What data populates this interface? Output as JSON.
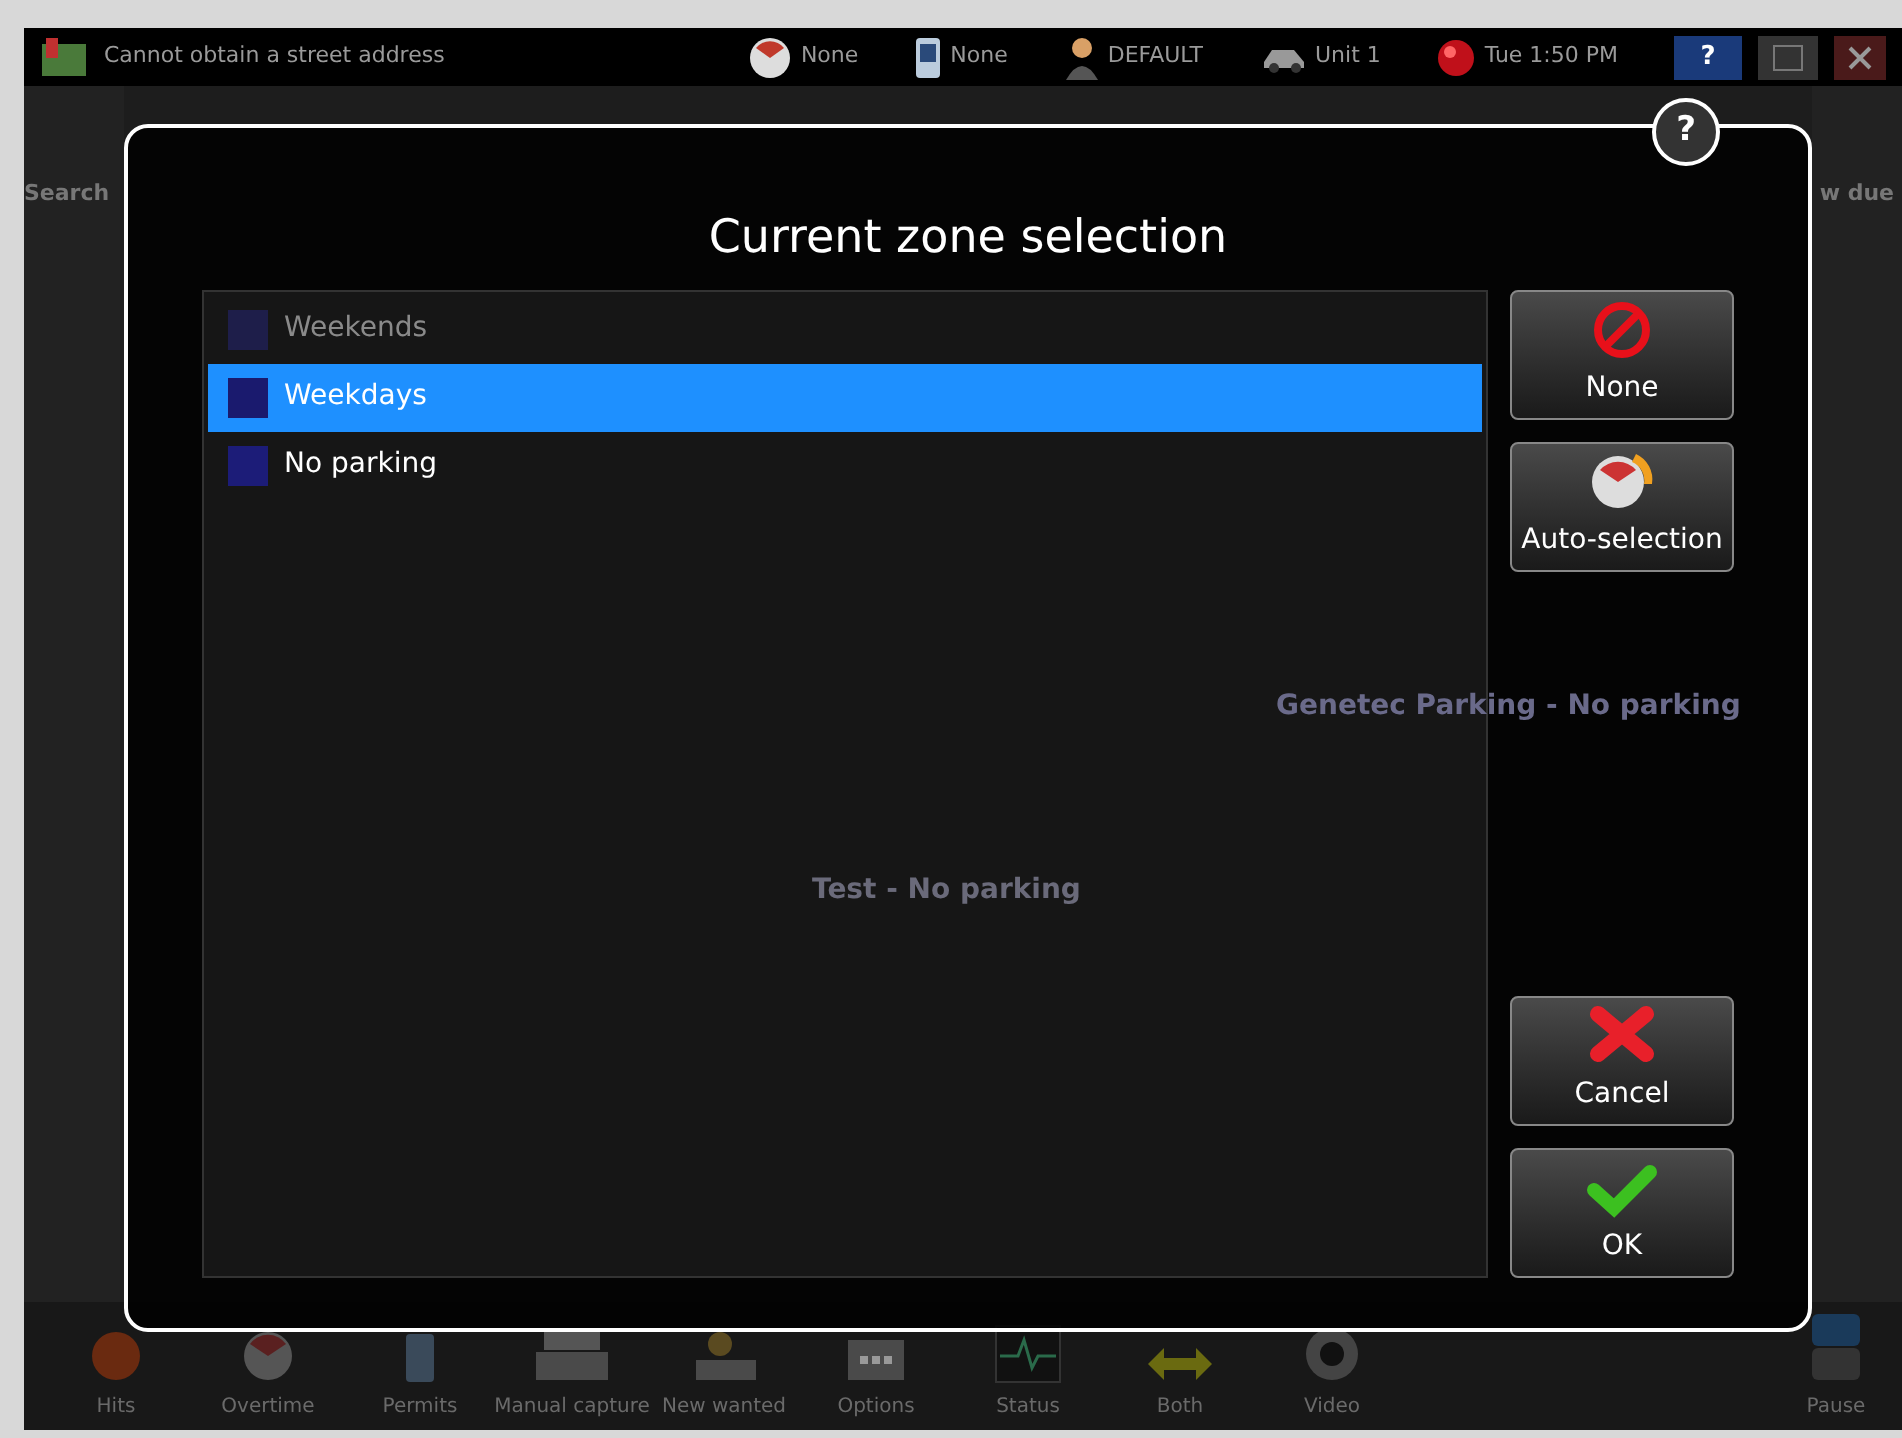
{
  "top_bar": {
    "location": "Cannot obtain a street address",
    "items": [
      {
        "kind": "gauge",
        "label": "None"
      },
      {
        "kind": "phone",
        "label": "None"
      },
      {
        "kind": "user",
        "label": "DEFAULT"
      },
      {
        "kind": "vehicle",
        "label": "Unit 1"
      },
      {
        "kind": "clock",
        "label": "Tue 1:50 PM"
      }
    ],
    "help": "?"
  },
  "side_labels": {
    "left": "Search",
    "right": "w due"
  },
  "map": {
    "labels": [
      "Genetec Parking - No parking",
      "Test - No parking"
    ]
  },
  "toolbar": [
    {
      "kind": "hits",
      "label": "Hits"
    },
    {
      "kind": "overtime",
      "label": "Overtime"
    },
    {
      "kind": "permits",
      "label": "Permits"
    },
    {
      "kind": "capture",
      "label": "Manual capture"
    },
    {
      "kind": "wanted",
      "label": "New wanted"
    },
    {
      "kind": "options",
      "label": "Options"
    },
    {
      "kind": "status",
      "label": "Status"
    },
    {
      "kind": "both",
      "label": "Both"
    },
    {
      "kind": "video",
      "label": "Video"
    },
    {
      "kind": "pause",
      "label": "Pause"
    }
  ],
  "dialog": {
    "title": "Current zone selection",
    "help": "?",
    "zones": [
      {
        "name": "Weekends",
        "color": "#1e1e4a",
        "selected": false,
        "disabled": true
      },
      {
        "name": "Weekdays",
        "color": "#1a1a6e",
        "selected": true,
        "disabled": false
      },
      {
        "name": "No parking",
        "color": "#1c1c78",
        "selected": false,
        "disabled": false
      }
    ],
    "buttons": [
      {
        "kind": "none",
        "label": "None"
      },
      {
        "kind": "auto",
        "label": "Auto-selection"
      },
      {
        "kind": "cancel",
        "label": "Cancel"
      },
      {
        "kind": "ok",
        "label": "OK"
      }
    ]
  }
}
